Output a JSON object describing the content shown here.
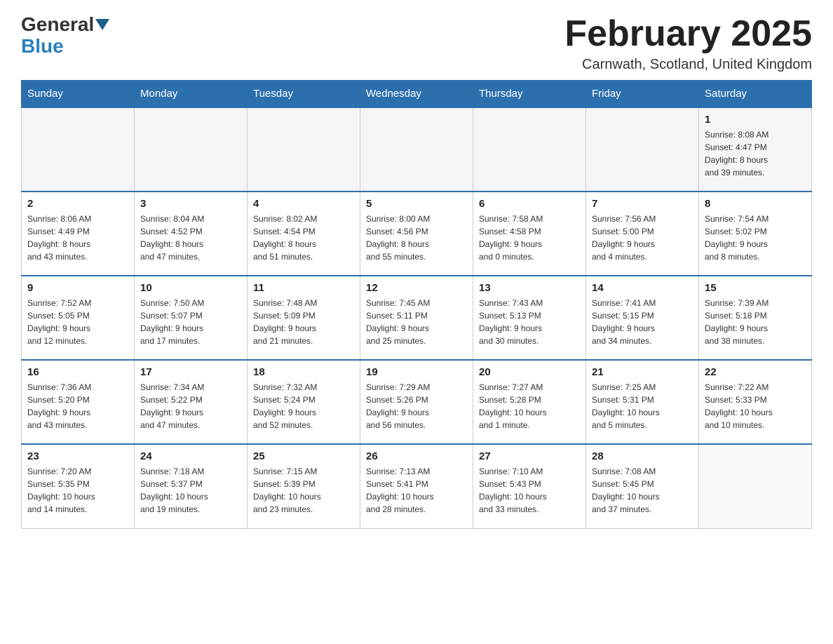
{
  "header": {
    "logo_line1": "General",
    "logo_line2": "Blue",
    "month_title": "February 2025",
    "location": "Carnwath, Scotland, United Kingdom"
  },
  "weekdays": [
    "Sunday",
    "Monday",
    "Tuesday",
    "Wednesday",
    "Thursday",
    "Friday",
    "Saturday"
  ],
  "weeks": [
    [
      {
        "day": "",
        "info": ""
      },
      {
        "day": "",
        "info": ""
      },
      {
        "day": "",
        "info": ""
      },
      {
        "day": "",
        "info": ""
      },
      {
        "day": "",
        "info": ""
      },
      {
        "day": "",
        "info": ""
      },
      {
        "day": "1",
        "info": "Sunrise: 8:08 AM\nSunset: 4:47 PM\nDaylight: 8 hours\nand 39 minutes."
      }
    ],
    [
      {
        "day": "2",
        "info": "Sunrise: 8:06 AM\nSunset: 4:49 PM\nDaylight: 8 hours\nand 43 minutes."
      },
      {
        "day": "3",
        "info": "Sunrise: 8:04 AM\nSunset: 4:52 PM\nDaylight: 8 hours\nand 47 minutes."
      },
      {
        "day": "4",
        "info": "Sunrise: 8:02 AM\nSunset: 4:54 PM\nDaylight: 8 hours\nand 51 minutes."
      },
      {
        "day": "5",
        "info": "Sunrise: 8:00 AM\nSunset: 4:56 PM\nDaylight: 8 hours\nand 55 minutes."
      },
      {
        "day": "6",
        "info": "Sunrise: 7:58 AM\nSunset: 4:58 PM\nDaylight: 9 hours\nand 0 minutes."
      },
      {
        "day": "7",
        "info": "Sunrise: 7:56 AM\nSunset: 5:00 PM\nDaylight: 9 hours\nand 4 minutes."
      },
      {
        "day": "8",
        "info": "Sunrise: 7:54 AM\nSunset: 5:02 PM\nDaylight: 9 hours\nand 8 minutes."
      }
    ],
    [
      {
        "day": "9",
        "info": "Sunrise: 7:52 AM\nSunset: 5:05 PM\nDaylight: 9 hours\nand 12 minutes."
      },
      {
        "day": "10",
        "info": "Sunrise: 7:50 AM\nSunset: 5:07 PM\nDaylight: 9 hours\nand 17 minutes."
      },
      {
        "day": "11",
        "info": "Sunrise: 7:48 AM\nSunset: 5:09 PM\nDaylight: 9 hours\nand 21 minutes."
      },
      {
        "day": "12",
        "info": "Sunrise: 7:45 AM\nSunset: 5:11 PM\nDaylight: 9 hours\nand 25 minutes."
      },
      {
        "day": "13",
        "info": "Sunrise: 7:43 AM\nSunset: 5:13 PM\nDaylight: 9 hours\nand 30 minutes."
      },
      {
        "day": "14",
        "info": "Sunrise: 7:41 AM\nSunset: 5:15 PM\nDaylight: 9 hours\nand 34 minutes."
      },
      {
        "day": "15",
        "info": "Sunrise: 7:39 AM\nSunset: 5:18 PM\nDaylight: 9 hours\nand 38 minutes."
      }
    ],
    [
      {
        "day": "16",
        "info": "Sunrise: 7:36 AM\nSunset: 5:20 PM\nDaylight: 9 hours\nand 43 minutes."
      },
      {
        "day": "17",
        "info": "Sunrise: 7:34 AM\nSunset: 5:22 PM\nDaylight: 9 hours\nand 47 minutes."
      },
      {
        "day": "18",
        "info": "Sunrise: 7:32 AM\nSunset: 5:24 PM\nDaylight: 9 hours\nand 52 minutes."
      },
      {
        "day": "19",
        "info": "Sunrise: 7:29 AM\nSunset: 5:26 PM\nDaylight: 9 hours\nand 56 minutes."
      },
      {
        "day": "20",
        "info": "Sunrise: 7:27 AM\nSunset: 5:28 PM\nDaylight: 10 hours\nand 1 minute."
      },
      {
        "day": "21",
        "info": "Sunrise: 7:25 AM\nSunset: 5:31 PM\nDaylight: 10 hours\nand 5 minutes."
      },
      {
        "day": "22",
        "info": "Sunrise: 7:22 AM\nSunset: 5:33 PM\nDaylight: 10 hours\nand 10 minutes."
      }
    ],
    [
      {
        "day": "23",
        "info": "Sunrise: 7:20 AM\nSunset: 5:35 PM\nDaylight: 10 hours\nand 14 minutes."
      },
      {
        "day": "24",
        "info": "Sunrise: 7:18 AM\nSunset: 5:37 PM\nDaylight: 10 hours\nand 19 minutes."
      },
      {
        "day": "25",
        "info": "Sunrise: 7:15 AM\nSunset: 5:39 PM\nDaylight: 10 hours\nand 23 minutes."
      },
      {
        "day": "26",
        "info": "Sunrise: 7:13 AM\nSunset: 5:41 PM\nDaylight: 10 hours\nand 28 minutes."
      },
      {
        "day": "27",
        "info": "Sunrise: 7:10 AM\nSunset: 5:43 PM\nDaylight: 10 hours\nand 33 minutes."
      },
      {
        "day": "28",
        "info": "Sunrise: 7:08 AM\nSunset: 5:45 PM\nDaylight: 10 hours\nand 37 minutes."
      },
      {
        "day": "",
        "info": ""
      }
    ]
  ]
}
